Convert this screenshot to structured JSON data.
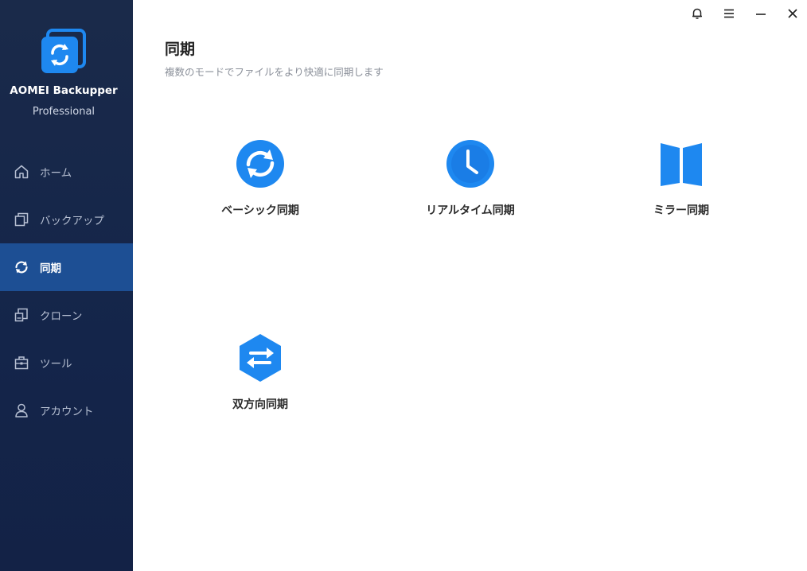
{
  "app": {
    "name": "AOMEI Backupper",
    "edition": "Professional"
  },
  "titlebar": {
    "bell_icon": "bell-icon",
    "menu_icon": "hamburger-menu-icon",
    "minimize_icon": "minimize-icon",
    "close_icon": "close-icon"
  },
  "sidebar": {
    "items": [
      {
        "label": "ホーム",
        "icon": "home-icon"
      },
      {
        "label": "バックアップ",
        "icon": "backup-icon"
      },
      {
        "label": "同期",
        "icon": "sync-icon",
        "active": true
      },
      {
        "label": "クローン",
        "icon": "clone-icon"
      },
      {
        "label": "ツール",
        "icon": "tools-icon"
      },
      {
        "label": "アカウント",
        "icon": "account-icon"
      }
    ]
  },
  "main": {
    "title": "同期",
    "subtitle": "複数のモードでファイルをより快適に同期します",
    "options": [
      {
        "label": "ベーシック同期",
        "icon": "basic-sync-icon"
      },
      {
        "label": "リアルタイム同期",
        "icon": "realtime-sync-clock-icon"
      },
      {
        "label": "ミラー同期",
        "icon": "mirror-sync-icon"
      },
      {
        "label": "双方向同期",
        "icon": "two-way-sync-icon"
      }
    ]
  },
  "colors": {
    "sidebar_bg": "#14254a",
    "sidebar_active": "#1d4f94",
    "accent_blue": "#1e88f0"
  }
}
